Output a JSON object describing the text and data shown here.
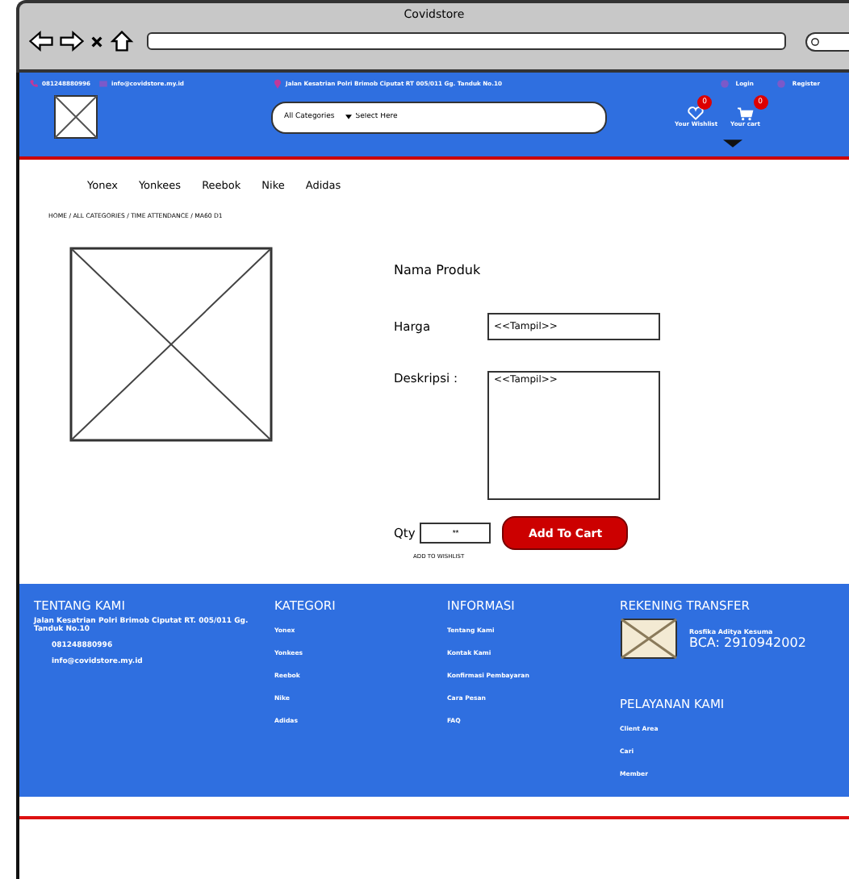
{
  "window": {
    "title": "Covidstore"
  },
  "top_bar": {
    "phone": "081248880996",
    "email": "info@covidstore.my.id",
    "address": "Jalan Kesatrian Polri Brimob Ciputat RT 005/011 Gg. Tanduk No.10",
    "links": [
      "Login",
      "Register"
    ]
  },
  "search": {
    "category": "All Categories",
    "placeholder": "Select Here"
  },
  "header_icons": [
    {
      "kind": "wishlist",
      "label": "Your Wishlist",
      "count": "0"
    },
    {
      "kind": "cart",
      "label": "Your cart",
      "count": "0"
    }
  ],
  "nav": [
    "Yonex",
    "Yonkees",
    "Reebok",
    "Nike",
    "Adidas"
  ],
  "breadcrumb": "HOME / ALL CATEGORIES / TIME ATTENDANCE / MA60 D1",
  "product": {
    "name": "Nama Produk",
    "price_label": "Harga",
    "price_value": "<<Tampil>>",
    "description_label": "Deskripsi :",
    "description_value": "<<Tampil>>",
    "qty_label": "Qty",
    "qty_value": "**",
    "add_button": "Add To Cart",
    "wishlist_link": "ADD TO WISHLIST"
  },
  "footer": {
    "about": {
      "title": "TENTANG KAMI",
      "address": "Jalan Kesatrian Polri Brimob Ciputat RT. 005/011 Gg. Tanduk No.10",
      "phone": "081248880996",
      "email": "info@covidstore.my.id"
    },
    "columns": [
      {
        "title": "KATEGORI",
        "items": [
          "Yonex",
          "Yonkees",
          "Reebok",
          "Nike",
          "Adidas"
        ]
      },
      {
        "title": "INFORMASI",
        "items": [
          "Tentang Kami",
          "Kontak Kami",
          "Konfirmasi Pembayaran",
          "Cara Pesan",
          "FAQ"
        ]
      }
    ],
    "transfer": {
      "title": "REKENING TRANSFER",
      "holder": "Rosfika Aditya Kesuma",
      "account": "BCA: 2910942002"
    },
    "services": {
      "title": "PELAYANAN KAMI",
      "items": [
        "Client Area",
        "Cari",
        "Member"
      ]
    }
  }
}
